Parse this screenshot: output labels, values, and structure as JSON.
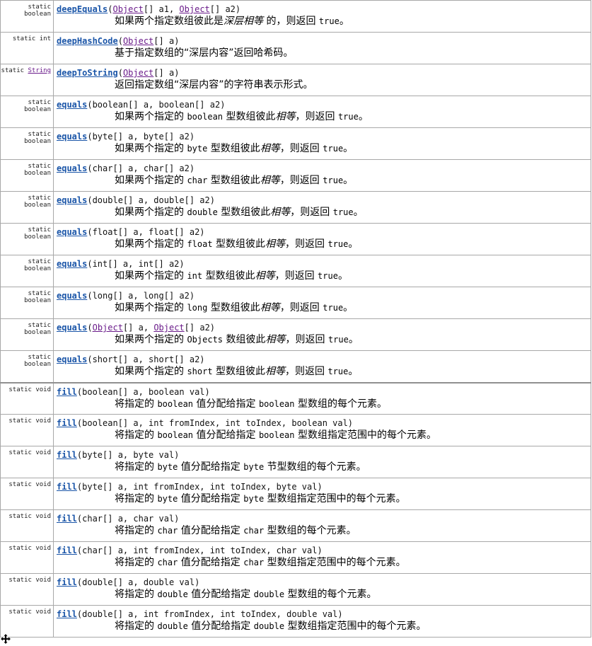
{
  "rows": [
    {
      "mod_pre": "static boolean",
      "mod_link": "",
      "name": "deepEquals",
      "params": [
        {
          "t": "(",
          "link": false
        },
        {
          "t": "Object",
          "link": true
        },
        {
          "t": "[] a1, ",
          "link": false
        },
        {
          "t": "Object",
          "link": true
        },
        {
          "t": "[] a2)",
          "link": false
        }
      ],
      "desc": [
        {
          "t": "如果两个指定数组彼此是",
          "k": "n"
        },
        {
          "t": "深层相等",
          "k": "i"
        },
        {
          "t": " 的，则返回 ",
          "k": "n"
        },
        {
          "t": "true",
          "k": "m"
        },
        {
          "t": "。",
          "k": "n"
        }
      ]
    },
    {
      "mod_pre": "static int",
      "mod_link": "",
      "name": "deepHashCode",
      "params": [
        {
          "t": "(",
          "link": false
        },
        {
          "t": "Object",
          "link": true
        },
        {
          "t": "[] a)",
          "link": false
        }
      ],
      "desc": [
        {
          "t": "基于指定数组的“深层内容”返回哈希码。",
          "k": "n"
        }
      ]
    },
    {
      "mod_pre": "static ",
      "mod_link": "String",
      "name": "deepToString",
      "params": [
        {
          "t": "(",
          "link": false
        },
        {
          "t": "Object",
          "link": true
        },
        {
          "t": "[] a)",
          "link": false
        }
      ],
      "desc": [
        {
          "t": "返回指定数组“深层内容”的字符串表示形式。",
          "k": "n"
        }
      ]
    },
    {
      "mod_pre": "static boolean",
      "mod_link": "",
      "name": "equals",
      "params": [
        {
          "t": "(boolean[] a, boolean[] a2)",
          "link": false
        }
      ],
      "desc": [
        {
          "t": "如果两个指定的 ",
          "k": "n"
        },
        {
          "t": "boolean",
          "k": "m"
        },
        {
          "t": " 型数组彼此",
          "k": "n"
        },
        {
          "t": "相等",
          "k": "i"
        },
        {
          "t": "，则返回 ",
          "k": "n"
        },
        {
          "t": "true",
          "k": "m"
        },
        {
          "t": "。",
          "k": "n"
        }
      ]
    },
    {
      "mod_pre": "static boolean",
      "mod_link": "",
      "name": "equals",
      "params": [
        {
          "t": "(byte[] a, byte[] a2)",
          "link": false
        }
      ],
      "desc": [
        {
          "t": "如果两个指定的 ",
          "k": "n"
        },
        {
          "t": "byte",
          "k": "m"
        },
        {
          "t": " 型数组彼此",
          "k": "n"
        },
        {
          "t": "相等",
          "k": "i"
        },
        {
          "t": "，则返回 ",
          "k": "n"
        },
        {
          "t": "true",
          "k": "m"
        },
        {
          "t": "。",
          "k": "n"
        }
      ]
    },
    {
      "mod_pre": "static boolean",
      "mod_link": "",
      "name": "equals",
      "params": [
        {
          "t": "(char[] a, char[] a2)",
          "link": false
        }
      ],
      "desc": [
        {
          "t": "如果两个指定的 ",
          "k": "n"
        },
        {
          "t": "char",
          "k": "m"
        },
        {
          "t": " 型数组彼此",
          "k": "n"
        },
        {
          "t": "相等",
          "k": "i"
        },
        {
          "t": "，则返回 ",
          "k": "n"
        },
        {
          "t": "true",
          "k": "m"
        },
        {
          "t": "。",
          "k": "n"
        }
      ]
    },
    {
      "mod_pre": "static boolean",
      "mod_link": "",
      "name": "equals",
      "params": [
        {
          "t": "(double[] a, double[] a2)",
          "link": false
        }
      ],
      "desc": [
        {
          "t": "如果两个指定的 ",
          "k": "n"
        },
        {
          "t": "double",
          "k": "m"
        },
        {
          "t": " 型数组彼此",
          "k": "n"
        },
        {
          "t": "相等",
          "k": "i"
        },
        {
          "t": "，则返回 ",
          "k": "n"
        },
        {
          "t": "true",
          "k": "m"
        },
        {
          "t": "。",
          "k": "n"
        }
      ]
    },
    {
      "mod_pre": "static boolean",
      "mod_link": "",
      "name": "equals",
      "params": [
        {
          "t": "(float[] a, float[] a2)",
          "link": false
        }
      ],
      "desc": [
        {
          "t": "如果两个指定的 ",
          "k": "n"
        },
        {
          "t": "float",
          "k": "m"
        },
        {
          "t": " 型数组彼此",
          "k": "n"
        },
        {
          "t": "相等",
          "k": "i"
        },
        {
          "t": "，则返回 ",
          "k": "n"
        },
        {
          "t": "true",
          "k": "m"
        },
        {
          "t": "。",
          "k": "n"
        }
      ]
    },
    {
      "mod_pre": "static boolean",
      "mod_link": "",
      "name": "equals",
      "params": [
        {
          "t": "(int[] a, int[] a2)",
          "link": false
        }
      ],
      "desc": [
        {
          "t": "如果两个指定的 ",
          "k": "n"
        },
        {
          "t": "int",
          "k": "m"
        },
        {
          "t": " 型数组彼此",
          "k": "n"
        },
        {
          "t": "相等",
          "k": "i"
        },
        {
          "t": "，则返回 ",
          "k": "n"
        },
        {
          "t": "true",
          "k": "m"
        },
        {
          "t": "。",
          "k": "n"
        }
      ]
    },
    {
      "mod_pre": "static boolean",
      "mod_link": "",
      "name": "equals",
      "params": [
        {
          "t": "(long[] a, long[] a2)",
          "link": false
        }
      ],
      "desc": [
        {
          "t": "如果两个指定的 ",
          "k": "n"
        },
        {
          "t": "long",
          "k": "m"
        },
        {
          "t": " 型数组彼此",
          "k": "n"
        },
        {
          "t": "相等",
          "k": "i"
        },
        {
          "t": "，则返回 ",
          "k": "n"
        },
        {
          "t": "true",
          "k": "m"
        },
        {
          "t": "。",
          "k": "n"
        }
      ]
    },
    {
      "mod_pre": "static boolean",
      "mod_link": "",
      "name": "equals",
      "params": [
        {
          "t": "(",
          "link": false
        },
        {
          "t": "Object",
          "link": true
        },
        {
          "t": "[] a, ",
          "link": false
        },
        {
          "t": "Object",
          "link": true
        },
        {
          "t": "[] a2)",
          "link": false
        }
      ],
      "desc": [
        {
          "t": "如果两个指定的 ",
          "k": "n"
        },
        {
          "t": "Objects",
          "k": "m"
        },
        {
          "t": " 数组彼此",
          "k": "n"
        },
        {
          "t": "相等",
          "k": "i"
        },
        {
          "t": "，则返回 ",
          "k": "n"
        },
        {
          "t": "true",
          "k": "m"
        },
        {
          "t": "。",
          "k": "n"
        }
      ]
    },
    {
      "mod_pre": "static boolean",
      "mod_link": "",
      "name": "equals",
      "params": [
        {
          "t": "(short[] a, short[] a2)",
          "link": false
        }
      ],
      "desc": [
        {
          "t": "如果两个指定的 ",
          "k": "n"
        },
        {
          "t": "short",
          "k": "m"
        },
        {
          "t": " 型数组彼此",
          "k": "n"
        },
        {
          "t": "相等",
          "k": "i"
        },
        {
          "t": "，则返回 ",
          "k": "n"
        },
        {
          "t": "true",
          "k": "m"
        },
        {
          "t": "。",
          "k": "n"
        }
      ]
    },
    {
      "mod_pre": "static void",
      "mod_link": "",
      "name": "fill",
      "sep": true,
      "params": [
        {
          "t": "(boolean[] a, boolean val)",
          "link": false
        }
      ],
      "desc": [
        {
          "t": "将指定的 ",
          "k": "n"
        },
        {
          "t": "boolean",
          "k": "m"
        },
        {
          "t": " 值分配给指定 ",
          "k": "n"
        },
        {
          "t": "boolean",
          "k": "m"
        },
        {
          "t": " 型数组的每个元素。",
          "k": "n"
        }
      ]
    },
    {
      "mod_pre": "static void",
      "mod_link": "",
      "name": "fill",
      "params": [
        {
          "t": "(boolean[] a, int fromIndex, int toIndex, boolean val)",
          "link": false
        }
      ],
      "desc": [
        {
          "t": "将指定的 ",
          "k": "n"
        },
        {
          "t": "boolean",
          "k": "m"
        },
        {
          "t": " 值分配给指定 ",
          "k": "n"
        },
        {
          "t": "boolean",
          "k": "m"
        },
        {
          "t": " 型数组指定范围中的每个元素。",
          "k": "n"
        }
      ]
    },
    {
      "mod_pre": "static void",
      "mod_link": "",
      "name": "fill",
      "params": [
        {
          "t": "(byte[] a, byte val)",
          "link": false
        }
      ],
      "desc": [
        {
          "t": "将指定的 ",
          "k": "n"
        },
        {
          "t": "byte",
          "k": "m"
        },
        {
          "t": " 值分配给指定 ",
          "k": "n"
        },
        {
          "t": "byte",
          "k": "m"
        },
        {
          "t": " 节型数组的每个元素。",
          "k": "n"
        }
      ]
    },
    {
      "mod_pre": "static void",
      "mod_link": "",
      "name": "fill",
      "params": [
        {
          "t": "(byte[] a, int fromIndex, int toIndex, byte val)",
          "link": false
        }
      ],
      "desc": [
        {
          "t": "将指定的 ",
          "k": "n"
        },
        {
          "t": "byte",
          "k": "m"
        },
        {
          "t": " 值分配给指定 ",
          "k": "n"
        },
        {
          "t": "byte",
          "k": "m"
        },
        {
          "t": " 型数组指定范围中的每个元素。",
          "k": "n"
        }
      ]
    },
    {
      "mod_pre": "static void",
      "mod_link": "",
      "name": "fill",
      "params": [
        {
          "t": "(char[] a, char val)",
          "link": false
        }
      ],
      "desc": [
        {
          "t": "将指定的 ",
          "k": "n"
        },
        {
          "t": "char",
          "k": "m"
        },
        {
          "t": " 值分配给指定 ",
          "k": "n"
        },
        {
          "t": "char",
          "k": "m"
        },
        {
          "t": " 型数组的每个元素。",
          "k": "n"
        }
      ]
    },
    {
      "mod_pre": "static void",
      "mod_link": "",
      "name": "fill",
      "params": [
        {
          "t": "(char[] a, int fromIndex, int toIndex, char val)",
          "link": false
        }
      ],
      "desc": [
        {
          "t": "将指定的 ",
          "k": "n"
        },
        {
          "t": "char",
          "k": "m"
        },
        {
          "t": " 值分配给指定 ",
          "k": "n"
        },
        {
          "t": "char",
          "k": "m"
        },
        {
          "t": " 型数组指定范围中的每个元素。",
          "k": "n"
        }
      ]
    },
    {
      "mod_pre": "static void",
      "mod_link": "",
      "name": "fill",
      "params": [
        {
          "t": "(double[] a, double val)",
          "link": false
        }
      ],
      "desc": [
        {
          "t": "将指定的 ",
          "k": "n"
        },
        {
          "t": "double",
          "k": "m"
        },
        {
          "t": " 值分配给指定 ",
          "k": "n"
        },
        {
          "t": "double",
          "k": "m"
        },
        {
          "t": " 型数组的每个元素。",
          "k": "n"
        }
      ]
    },
    {
      "mod_pre": "static void",
      "mod_link": "",
      "name": "fill",
      "params": [
        {
          "t": "(double[] a, int fromIndex, int toIndex, double val)",
          "link": false
        }
      ],
      "desc": [
        {
          "t": "将指定的 ",
          "k": "n"
        },
        {
          "t": "double",
          "k": "m"
        },
        {
          "t": " 值分配给指定 ",
          "k": "n"
        },
        {
          "t": "double",
          "k": "m"
        },
        {
          "t": " 型数组指定范围中的每个元素。",
          "k": "n"
        }
      ]
    }
  ]
}
